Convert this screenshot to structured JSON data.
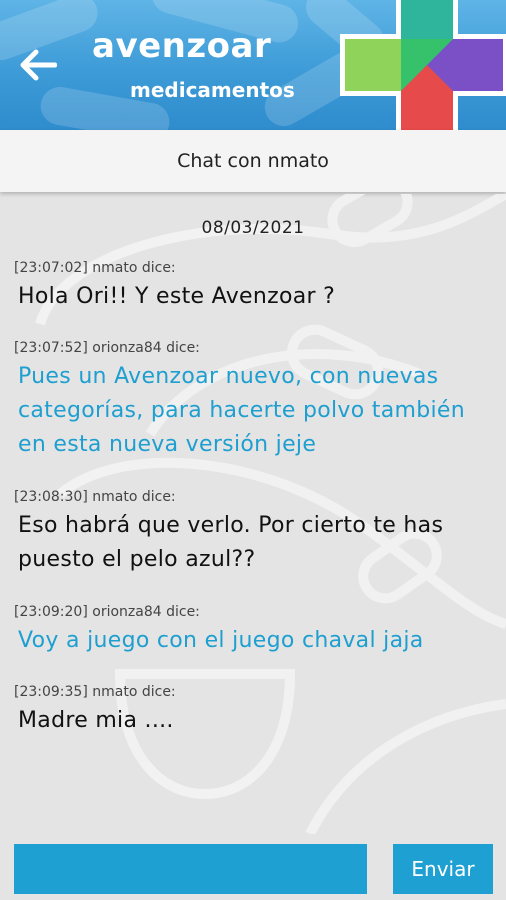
{
  "header": {
    "brand_title": "avenzoar",
    "brand_subtitle": "medicamentos",
    "colors": {
      "bg": "#3d9bd7",
      "logo": [
        "#35c26a",
        "#f4b93a",
        "#e64a4a",
        "#7b4fc6",
        "#3b7fd9"
      ]
    }
  },
  "title_bar": {
    "title": "Chat con nmato"
  },
  "chat": {
    "date": "08/03/2021",
    "messages": [
      {
        "meta": "[23:07:02] nmato dice:",
        "text": "Hola Ori!! Y este Avenzoar ?",
        "own": false
      },
      {
        "meta": "[23:07:52] orionza84 dice:",
        "text": "Pues un Avenzoar nuevo, con nuevas categorías, para hacerte polvo también en esta nueva versión jeje",
        "own": true
      },
      {
        "meta": "[23:08:30] nmato dice:",
        "text": "Eso habrá que verlo. Por cierto te has puesto el pelo azul??",
        "own": false
      },
      {
        "meta": "[23:09:20] orionza84 dice:",
        "text": "Voy a juego con el juego chaval jaja",
        "own": true
      },
      {
        "meta": "[23:09:35] nmato dice:",
        "text": "Madre mia ....",
        "own": false
      }
    ]
  },
  "composer": {
    "value": "",
    "send_label": "Enviar",
    "accent": "#1fa0d2"
  }
}
